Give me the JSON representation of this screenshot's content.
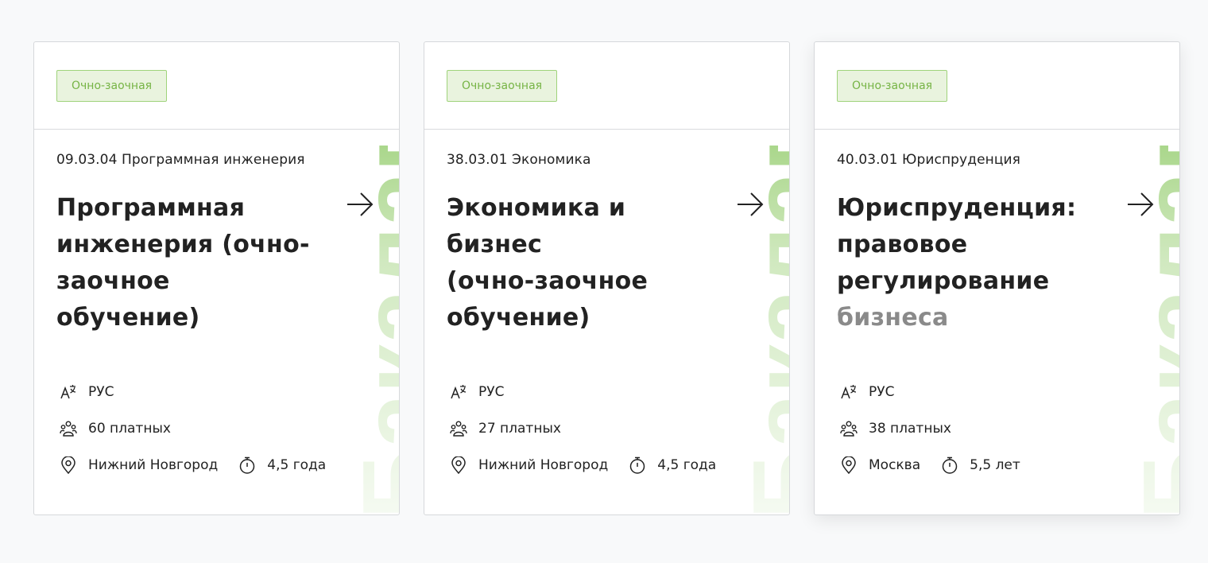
{
  "colors": {
    "accent_green": "#8bc861",
    "badge_text": "#76b445",
    "badge_bg": "#e9f3de",
    "badge_border": "#9fd37b",
    "muted_text": "#8a8a8a"
  },
  "cards": [
    {
      "badge": "Очно-заочная",
      "code": "09.03.04 Программная инженерия",
      "title_lines": [
        "Программная",
        "инженерия (очно-",
        "заочное обучение)"
      ],
      "title_muted": "",
      "side_word": "Бакалавр",
      "language": "РУС",
      "seats": "60 платных",
      "city": "Нижний Новгород",
      "duration": "4,5 года",
      "icons": [
        "language-icon",
        "people-icon",
        "location-pin-icon",
        "stopwatch-icon",
        "arrow-right-icon"
      ]
    },
    {
      "badge": "Очно-заочная",
      "code": "38.03.01 Экономика",
      "title_lines": [
        "Экономика и бизнес",
        "(очно-заочное",
        "обучение)"
      ],
      "title_muted": "",
      "side_word": "Бакалавр",
      "language": "РУС",
      "seats": "27 платных",
      "city": "Нижний Новгород",
      "duration": "4,5 года",
      "icons": [
        "language-icon",
        "people-icon",
        "location-pin-icon",
        "stopwatch-icon",
        "arrow-right-icon"
      ]
    },
    {
      "badge": "Очно-заочная",
      "code": "40.03.01 Юриспруденция",
      "title_lines": [
        "Юриспруденция:",
        "правовое",
        "регулирование"
      ],
      "title_muted": "бизнеса",
      "side_word": "Бакалавр",
      "language": "РУС",
      "seats": "38 платных",
      "city": "Москва",
      "duration": "5,5 лет",
      "icons": [
        "language-icon",
        "people-icon",
        "location-pin-icon",
        "stopwatch-icon",
        "arrow-right-icon"
      ]
    }
  ]
}
